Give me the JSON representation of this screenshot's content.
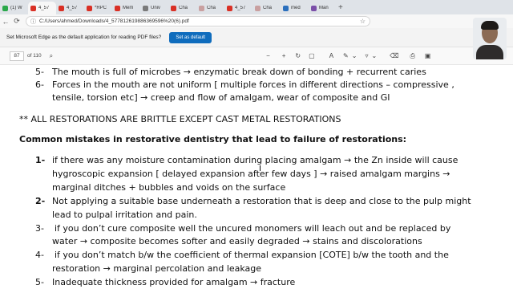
{
  "browser": {
    "tabs": [
      {
        "label": "(1) W",
        "color": "#2aa84a",
        "active": false
      },
      {
        "label": "4_57",
        "color": "#d93025",
        "active": true
      },
      {
        "label": "4_57",
        "color": "#d93025",
        "active": false
      },
      {
        "label": "*RPC",
        "color": "#d93025",
        "active": false
      },
      {
        "label": "Mem",
        "color": "#d93025",
        "active": false
      },
      {
        "label": "Univ",
        "color": "#7a7a7a",
        "active": false
      },
      {
        "label": "Cha",
        "color": "#d93025",
        "active": false
      },
      {
        "label": "Cha",
        "color": "#c9a0a0",
        "active": false
      },
      {
        "label": "4_57",
        "color": "#d93025",
        "active": false
      },
      {
        "label": "Cha",
        "color": "#c9a0a0",
        "active": false
      },
      {
        "label": "med",
        "color": "#2a6fbd",
        "active": false
      },
      {
        "label": "Man",
        "color": "#7b4fa8",
        "active": false
      }
    ],
    "address": "C:/Users/ahmed/Downloads/4_577812619886369596%20(6).pdf"
  },
  "banner": {
    "message": "Set Microsoft Edge as the default application for reading PDF files?",
    "button": "Set as default"
  },
  "pdf_toolbar": {
    "page_current": "87",
    "page_total": "of 110"
  },
  "document": {
    "l1_num": "5-",
    "l1": "The mouth is full of microbes → enzymatic break down of bonding + recurrent caries",
    "l2_num": "6-",
    "l2": "Forces in the mouth are not uniform [ multiple forces in different directions – compressive ,",
    "l3": "tensile, torsion etc] → creep and flow of amalgam, wear of composite and GI",
    "l4": "** ALL RESTORATIONS ARE BRITTLE EXCEPT CAST METAL RESTORATIONS",
    "l5": "Common mistakes in restorative dentistry that lead to failure of restorations:",
    "m1_num": "1-",
    "m1a": "if there was any moisture contamination during placing amalgam → the Zn inside will cause",
    "m1b": "hygroscopic expansion [ delayed expansion after few days ] → raised amalgam margins →",
    "m1c": "marginal ditches + bubbles and voids on the surface",
    "m2_num": "2-",
    "m2a": "Not applying a suitable base underneath a restoration that is deep and close to the pulp might",
    "m2b": "lead to pulpal irritation and pain.",
    "m3_num": "3-",
    "m3a": "if you don’t cure composite well the uncured monomers will leach out and be replaced by",
    "m3b": "water → composite becomes softer and easily degraded → stains and discolorations",
    "m4_num": "4-",
    "m4a": "if you don’t match b/w the coefficient of thermal expansion [COTE] b/w the tooth and the",
    "m4b": "restoration → marginal percolation and leakage",
    "m5_num": "5-",
    "m5a": "Inadequate thickness provided for amalgam → fracture"
  }
}
